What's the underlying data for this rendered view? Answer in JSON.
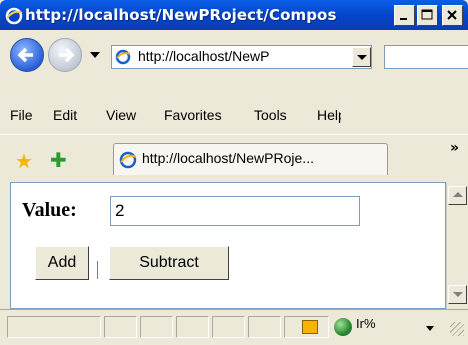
{
  "window": {
    "title": "http://localhost/NewPRoject/Compos"
  },
  "address_bar": {
    "url": "http://localhost/NewP"
  },
  "menu": {
    "file": "File",
    "edit": "Edit",
    "view": "View",
    "favorites": "Favorites",
    "tools": "Tools",
    "help": "Help"
  },
  "tab": {
    "title": "http://localhost/NewPRoje..."
  },
  "form": {
    "value_label": "Value:",
    "value": "2",
    "add_label": "Add",
    "subtract_label": "Subtract"
  },
  "statusbar": {
    "zoom_text": "Ir%"
  },
  "icons": {
    "browser": "ie-icon",
    "back": "back-arrow-icon",
    "forward": "forward-arrow-icon",
    "favorites": "star-icon",
    "add_favorite": "add-star-icon",
    "security": "lock-icon",
    "zone": "globe-icon"
  },
  "colors": {
    "titlebar": "#0543c8",
    "chrome": "#ece9d8"
  }
}
